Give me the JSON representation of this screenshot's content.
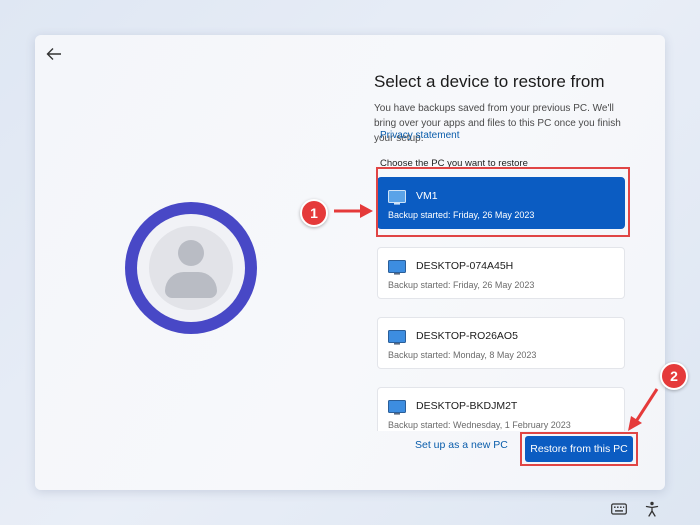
{
  "page": {
    "title": "Select a device to restore from",
    "description": "You have backups saved from your previous PC. We'll bring over your apps and files to this PC once you finish your setup.",
    "privacy_link": "Privacy statement",
    "choose_label": "Choose the PC you want to restore"
  },
  "devices": [
    {
      "name": "VM1",
      "backup": "Backup started: Friday, 26 May 2023",
      "selected": true
    },
    {
      "name": "DESKTOP-074A45H",
      "backup": "Backup started: Friday, 26 May 2023",
      "selected": false
    },
    {
      "name": "DESKTOP-RO26AO5",
      "backup": "Backup started: Monday, 8 May 2023",
      "selected": false
    },
    {
      "name": "DESKTOP-BKDJM2T",
      "backup": "Backup started: Wednesday, 1 February 2023",
      "selected": false
    }
  ],
  "actions": {
    "setup_new": "Set up as a new PC",
    "restore": "Restore from this PC"
  },
  "annotations": {
    "marker1": "1",
    "marker2": "2"
  },
  "icons": {
    "back": "back-arrow-icon",
    "avatar": "user-avatar-icon",
    "device": "monitor-icon",
    "keyboard": "keyboard-icon",
    "accessibility": "accessibility-icon"
  },
  "colors": {
    "accent": "#0b5cc2",
    "avatar_ring": "#4848c6",
    "annotation": "#e04545"
  }
}
